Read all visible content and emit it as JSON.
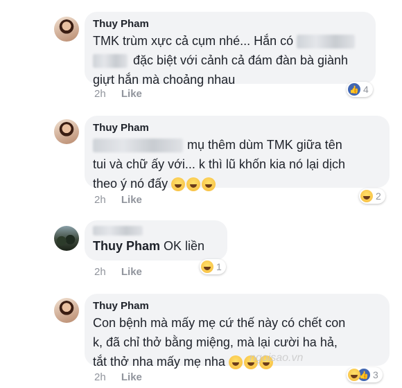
{
  "comments": [
    {
      "author": "Thuy Pham",
      "line1": "TMK trùm xực cả cụm nhé... Hắn có",
      "line2": "đặc biệt với cảnh cả đám đàn bà giành",
      "line3": "giựt hắn mà choảng nhau",
      "time": "2h",
      "like": "Like",
      "reaction_icon": "like-icon",
      "reaction_count": "4"
    },
    {
      "author": "Thuy Pham",
      "line1": "mụ thêm dùm TMK giữa tên",
      "line2": "tui và chữ ấy với... k thì lũ khốn kia nó lại dịch",
      "line3": "theo ý nó đấy",
      "time": "2h",
      "like": "Like",
      "reaction_icon": "haha-icon",
      "reaction_count": "2"
    },
    {
      "tag": "Thuy Pham",
      "line1": "OK liền",
      "time": "2h",
      "like": "Like",
      "reaction_icon": "haha-icon",
      "reaction_count": "1"
    },
    {
      "author": "Thuy Pham",
      "line1": "Con bệnh mà mấy mẹ cứ thế này có chết con",
      "line2": "k, đã chỉ thở bằng miệng, mà lại cười ha hả,",
      "line3": "tắt thở nha mấy mẹ nha",
      "time": "2h",
      "like": "Like",
      "reaction_icon": "haha-like-icons",
      "reaction_count": "3"
    }
  ],
  "watermark": "ngoisao.vn",
  "colors": {
    "bubble": "#f2f3f5",
    "meta": "#90949c",
    "like_blue": "#4267b2"
  }
}
